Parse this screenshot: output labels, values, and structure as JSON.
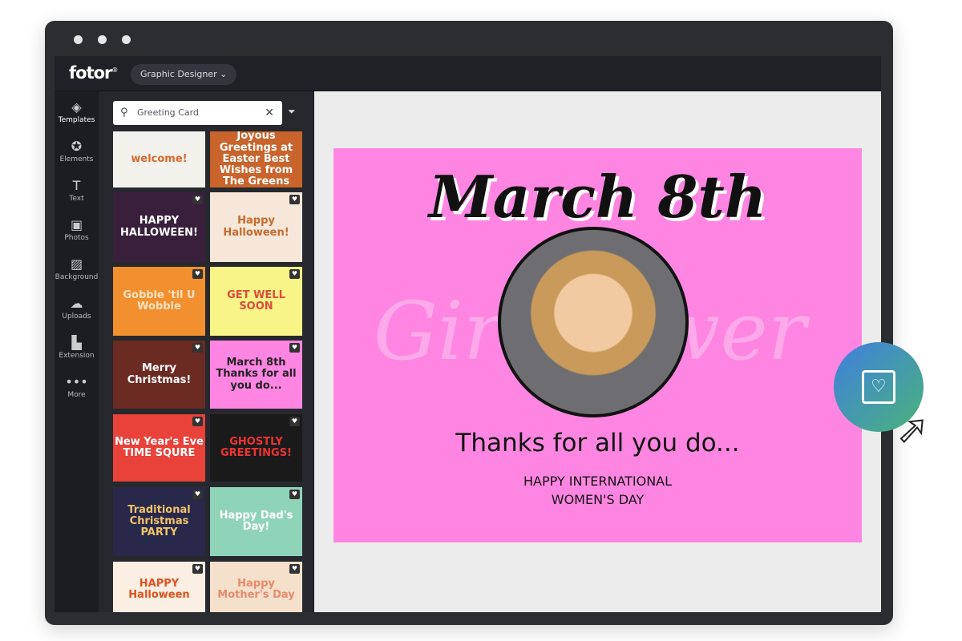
{
  "app": {
    "logo": "fotor",
    "mode": "Graphic Designer"
  },
  "rail": [
    {
      "label": "Templates",
      "icon": "layers-icon"
    },
    {
      "label": "Elements",
      "icon": "star-icon"
    },
    {
      "label": "Text",
      "icon": "text-icon"
    },
    {
      "label": "Photos",
      "icon": "photo-icon"
    },
    {
      "label": "Background",
      "icon": "stripes-icon"
    },
    {
      "label": "Uploads",
      "icon": "cloud-upload-icon"
    },
    {
      "label": "Extension",
      "icon": "puzzle-icon"
    },
    {
      "label": "More",
      "icon": "more-icon"
    }
  ],
  "search": {
    "value": "Greeting Card"
  },
  "thumbs": [
    {
      "text": "welcome!",
      "bg": "#f3f1ec",
      "fg": "#d9692a"
    },
    {
      "text": "Joyous Greetings at Easter Best Wishes from The Greens",
      "bg": "#c9642c",
      "fg": "#fff"
    },
    {
      "text": "HAPPY HALLOWEEN!",
      "bg": "#3a1f3d",
      "fg": "#fff"
    },
    {
      "text": "Happy Halloween!",
      "bg": "#f6e7da",
      "fg": "#c56b2c"
    },
    {
      "text": "Gobble 'til U Wobble",
      "bg": "#f28f2e",
      "fg": "#fde3c2"
    },
    {
      "text": "GET WELL SOON",
      "bg": "#f8f488",
      "fg": "#e04a3c"
    },
    {
      "text": "Merry Christmas!",
      "bg": "#6b2a22",
      "fg": "#fff"
    },
    {
      "text": "March 8th Thanks for all you do...",
      "bg": "#ff85e3",
      "fg": "#222"
    },
    {
      "text": "New Year's Eve TIME SQURE",
      "bg": "#e8423a",
      "fg": "#fff"
    },
    {
      "text": "GHOSTLY GREETINGS!",
      "bg": "#1a1a1a",
      "fg": "#e33"
    },
    {
      "text": "Traditional Christmas PARTY",
      "bg": "#28284a",
      "fg": "#f0c46a"
    },
    {
      "text": "Happy Dad's Day!",
      "bg": "#8fd3b8",
      "fg": "#fff"
    },
    {
      "text": "HAPPY Halloween",
      "bg": "#fbeee2",
      "fg": "#e0521e"
    },
    {
      "text": "Happy Mother's Day",
      "bg": "#f5e0cc",
      "fg": "#e98a6a"
    }
  ],
  "card": {
    "title": "March 8th",
    "watermark": "Girl Power",
    "thanks": "Thanks for all you do...",
    "line1": "HAPPY INTERNATIONAL",
    "line2": "WOMEN'S DAY",
    "bg": "#ff85e3"
  }
}
